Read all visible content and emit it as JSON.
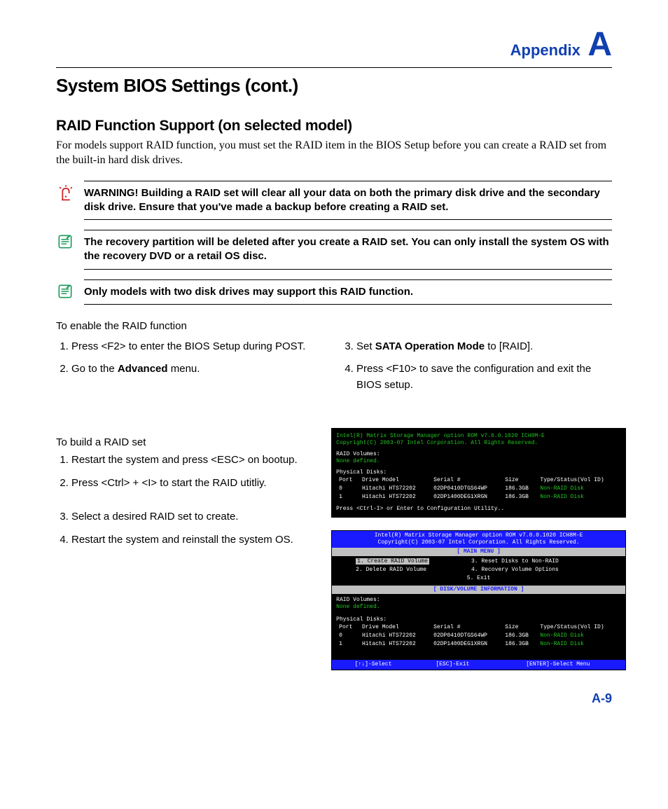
{
  "appendix": {
    "label": "Appendix",
    "letter": "A"
  },
  "title": "System BIOS Settings (cont.)",
  "subsection": "RAID Function Support (on selected model)",
  "intro": "For models support RAID function, you must set the RAID item in the BIOS Setup before you can create a RAID set from the built-in hard disk drives.",
  "notes": {
    "warn": "WARNING! Building a RAID set will clear all your data on both the primary disk drive and the secondary disk drive. Ensure that you've made a backup before creating a RAID set.",
    "info1": "The recovery partition will be deleted after you create a RAID set. You can only install the system OS with the recovery DVD or a retail OS disc.",
    "info2": "Only models with two disk drives may support this RAID function."
  },
  "enable": {
    "heading": "To enable the RAID function",
    "left1_a": "Press <F2> to enter the BIOS Setup during POST.",
    "left2_a": "Go to the ",
    "left2_b": "Advanced",
    "left2_c": " menu.",
    "right3_a": "Set ",
    "right3_b": "SATA Operation Mode",
    "right3_c": " to [RAID].",
    "right4": "Press <F10> to save the configuration and exit the BIOS setup."
  },
  "build": {
    "heading": "To build a RAID set",
    "s1": "Restart the system and press <ESC> on bootup.",
    "s2": "Press <Ctrl> + <I> to start the RAID utitliy.",
    "s3": "Select a desired RAID set to create.",
    "s4": "Restart the system and reinstall the system OS."
  },
  "bios1": {
    "hdr1": "Intel(R) Matrix Storage Manager option ROM v7.0.0.1020 ICH8M-E",
    "hdr2": "Copyright(C) 2003-07 Intel Corporation. All Rights Reserved.",
    "raid_vol_lbl": "RAID Volumes:",
    "none_defined": "None defined.",
    "phys_lbl": "Physical Disks:",
    "cols": {
      "port": "Port",
      "model": "Drive Model",
      "serial": "Serial #",
      "size": "Size",
      "type": "Type/Status(Vol ID)"
    },
    "rows": [
      {
        "port": "0",
        "model": "Hitachi HTS72202",
        "serial": "02DP0410DTGS64WP",
        "size": "186.3GB",
        "type": "Non-RAID Disk"
      },
      {
        "port": "1",
        "model": "Hitachi HTS72202",
        "serial": "02DP1400DEG1XRGN",
        "size": "186.3GB",
        "type": "Non-RAID Disk"
      }
    ],
    "footer": "Press <Ctrl-I> or Enter to Configuration Utility.."
  },
  "bios2": {
    "menu_title": "[ MAIN MENU ]",
    "m1": "1. Create RAID Volume",
    "m2": "2. Delete RAID Volume",
    "m3": "3. Reset Disks to Non-RAID",
    "m4": "4. Recovery Volume Options",
    "m5": "5. Exit",
    "info_title": "[ DISK/VOLUME INFORMATION ]",
    "foot_sel": "[↑↓]-Select",
    "foot_esc": "[ESC]-Exit",
    "foot_ent": "[ENTER]-Select Menu"
  },
  "page_num": "A-9"
}
